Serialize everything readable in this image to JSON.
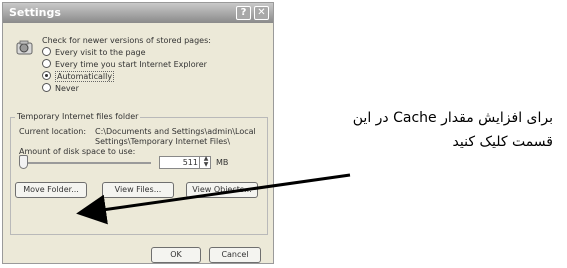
{
  "dialog": {
    "title": "Settings",
    "help_glyph": "?",
    "close_glyph": "✕",
    "check_heading": "Check for newer versions of stored pages:",
    "options": [
      {
        "label": "Every visit to the page",
        "selected": false
      },
      {
        "label": "Every time you start Internet Explorer",
        "selected": false
      },
      {
        "label": "Automatically",
        "selected": true
      },
      {
        "label": "Never",
        "selected": false
      }
    ],
    "group_title": "Temporary Internet files folder",
    "current_location_label": "Current location:",
    "current_location_line1": "C:\\Documents and Settings\\admin\\Local",
    "current_location_line2": "Settings\\Temporary Internet Files\\",
    "disk_space_label": "Amount of disk space to use:",
    "disk_space_value": "511",
    "disk_space_unit": "MB",
    "buttons": {
      "move_folder": "Move Folder...",
      "view_files": "View Files...",
      "view_objects": "View Objects...",
      "ok": "OK",
      "cancel": "Cancel"
    }
  },
  "annotation": {
    "line1": "برای افزایش مقدار Cache در این",
    "line2": "قسمت کلیک کنید"
  }
}
